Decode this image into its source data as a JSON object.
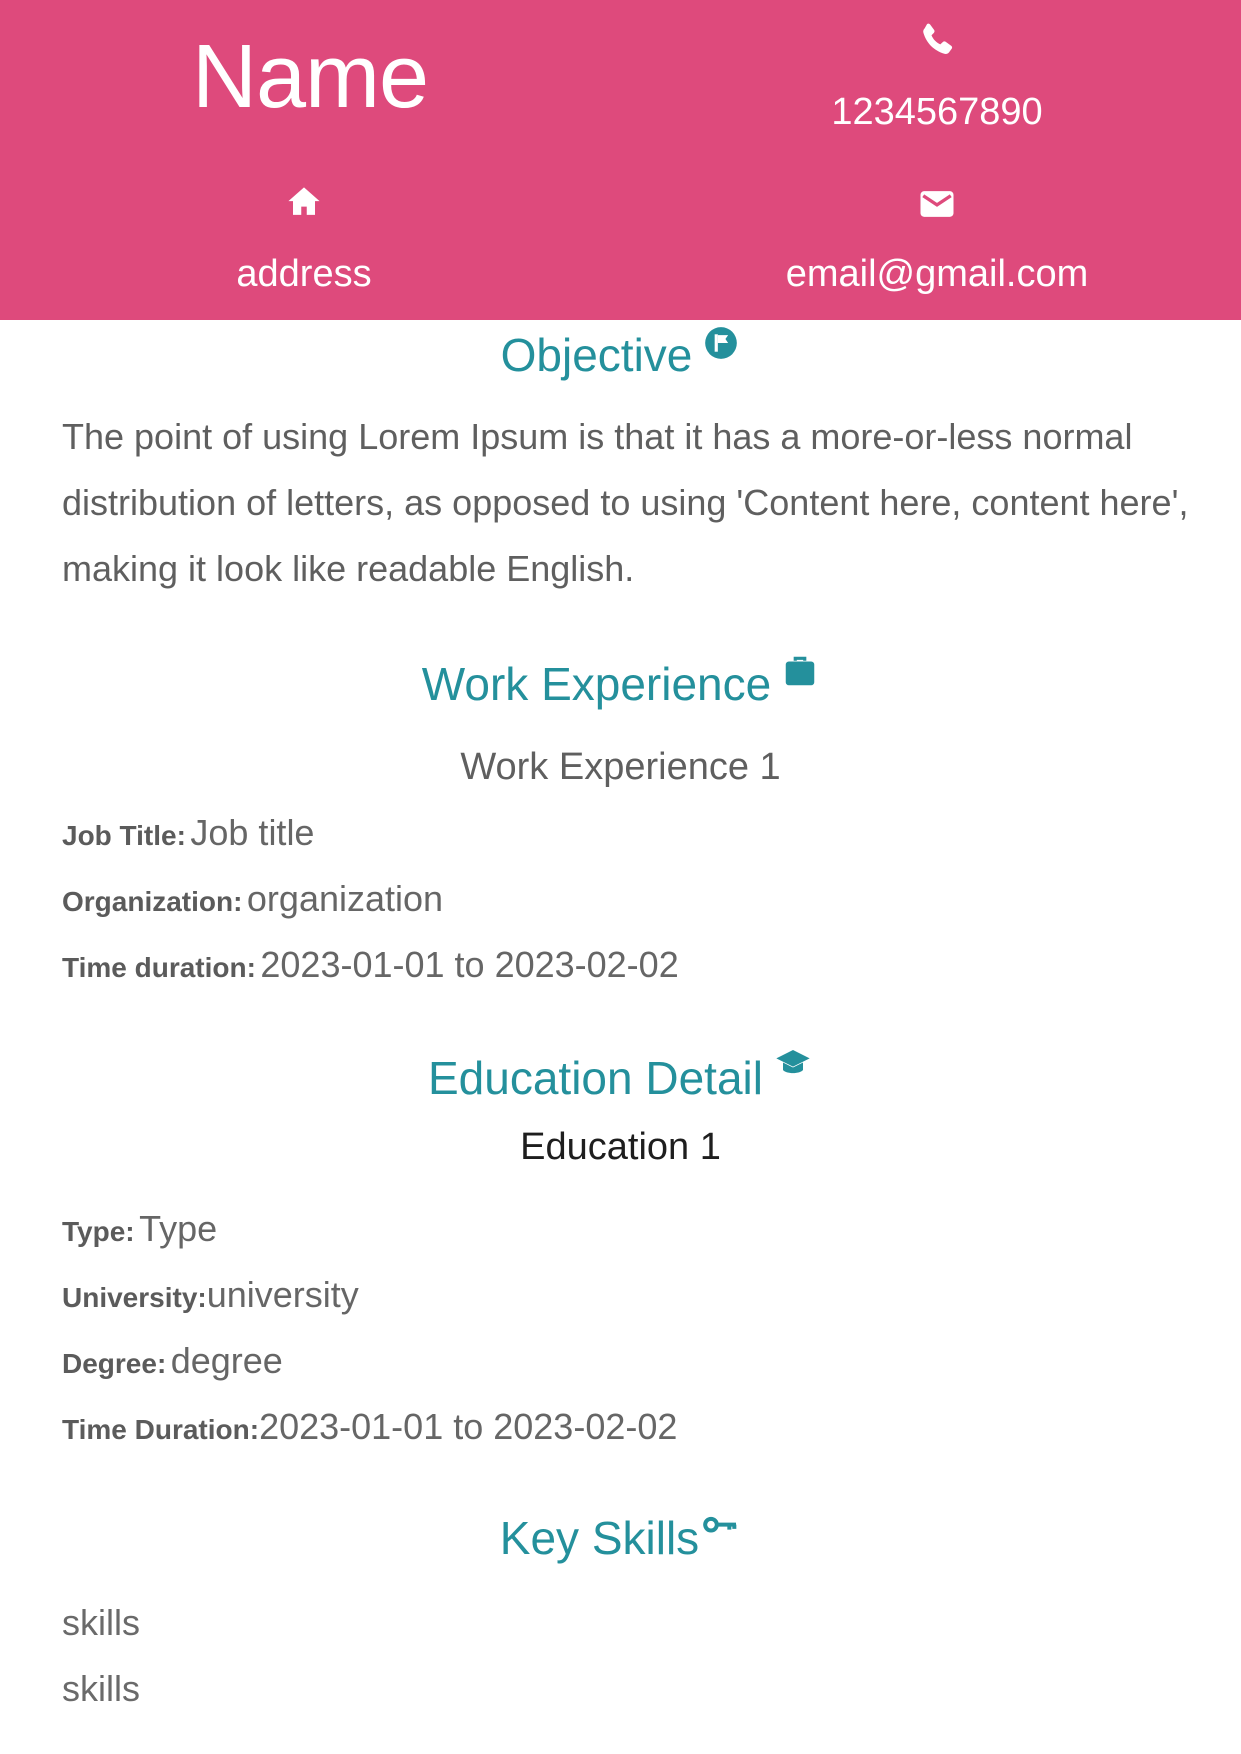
{
  "header": {
    "name": "Name",
    "phone": "1234567890",
    "address": "address",
    "email": "email@gmail.com",
    "icons": {
      "phone": "phone-icon",
      "home": "home-icon",
      "email": "envelope-icon"
    },
    "background_color": "#de4a7c"
  },
  "objective": {
    "title": "Objective",
    "icon": "flag-circle-icon",
    "text": "The point of using Lorem Ipsum is that it has a more-or-less normal distribution of letters, as opposed to using 'Content here, content here', making it look like readable English."
  },
  "work": {
    "title": "Work Experience",
    "icon": "briefcase-icon",
    "entry_title": "Work Experience 1",
    "job_title_label": "Job Title:",
    "job_title": "Job title",
    "organization_label": "Organization:",
    "organization": "organization",
    "duration_label": "Time duration:",
    "duration": "2023-01-01 to 2023-02-02"
  },
  "education": {
    "title": "Education Detail",
    "icon": "graduation-cap-icon",
    "entry_title": "Education 1",
    "type_label": "Type:",
    "type": "Type",
    "university_label": "University:",
    "university": "university",
    "degree_label": "Degree:",
    "degree": "degree",
    "duration_label": "Time Duration:",
    "duration": "2023-01-01 to 2023-02-02"
  },
  "skills": {
    "title": "Key Skills",
    "icon": "key-icon",
    "items": [
      "skills",
      "skills"
    ]
  },
  "colors": {
    "accent": "#24909c",
    "header": "#de4a7c"
  }
}
